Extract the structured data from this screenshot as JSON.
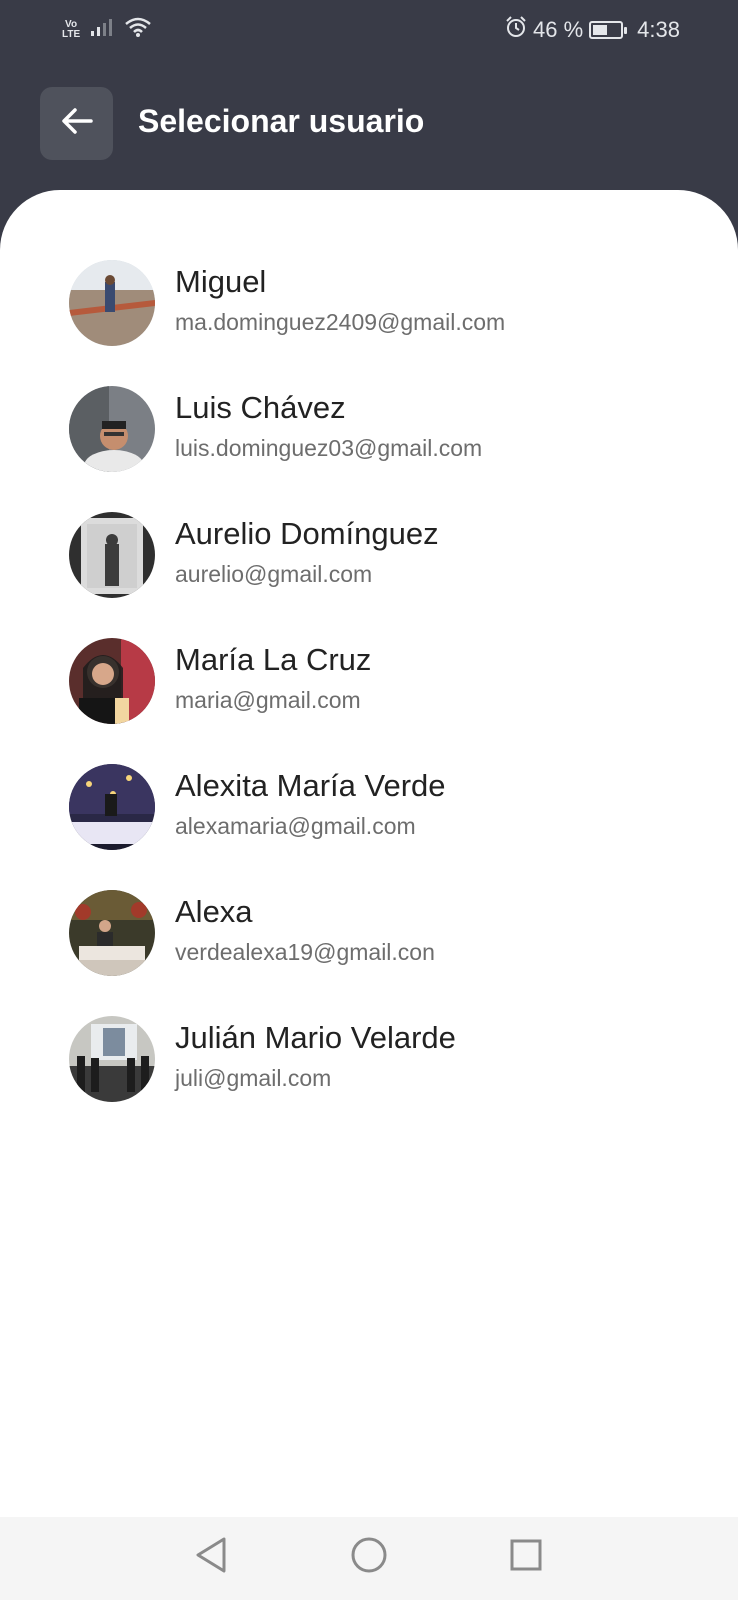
{
  "status_bar": {
    "network_label_top": "Vo",
    "network_label_bottom": "LTE",
    "battery_percent": "46 %",
    "battery_level": 0.46,
    "time": "4:38",
    "icons": [
      "signal-icon",
      "wifi-icon",
      "alarm-icon",
      "battery-icon"
    ]
  },
  "header": {
    "back_icon": "arrow-left-icon",
    "title": "Selecionar usuario",
    "background": "#393b47"
  },
  "users": [
    {
      "name": "Miguel",
      "email": "ma.dominguez2409@gmail.com"
    },
    {
      "name": "Luis Chávez",
      "email": "luis.dominguez03@gmail.com"
    },
    {
      "name": "Aurelio Domínguez",
      "email": "aurelio@gmail.com"
    },
    {
      "name": "María La Cruz",
      "email": "maria@gmail.com"
    },
    {
      "name": "Alexita María Verde",
      "email": "alexamaria@gmail.com"
    },
    {
      "name": "Alexa",
      "email": "verdealexa19@gmail.con"
    },
    {
      "name": "Julián Mario Velarde",
      "email": "juli@gmail.com"
    }
  ],
  "nav_bar": {
    "icons": [
      "back-triangle-icon",
      "home-circle-icon",
      "recents-square-icon"
    ]
  }
}
